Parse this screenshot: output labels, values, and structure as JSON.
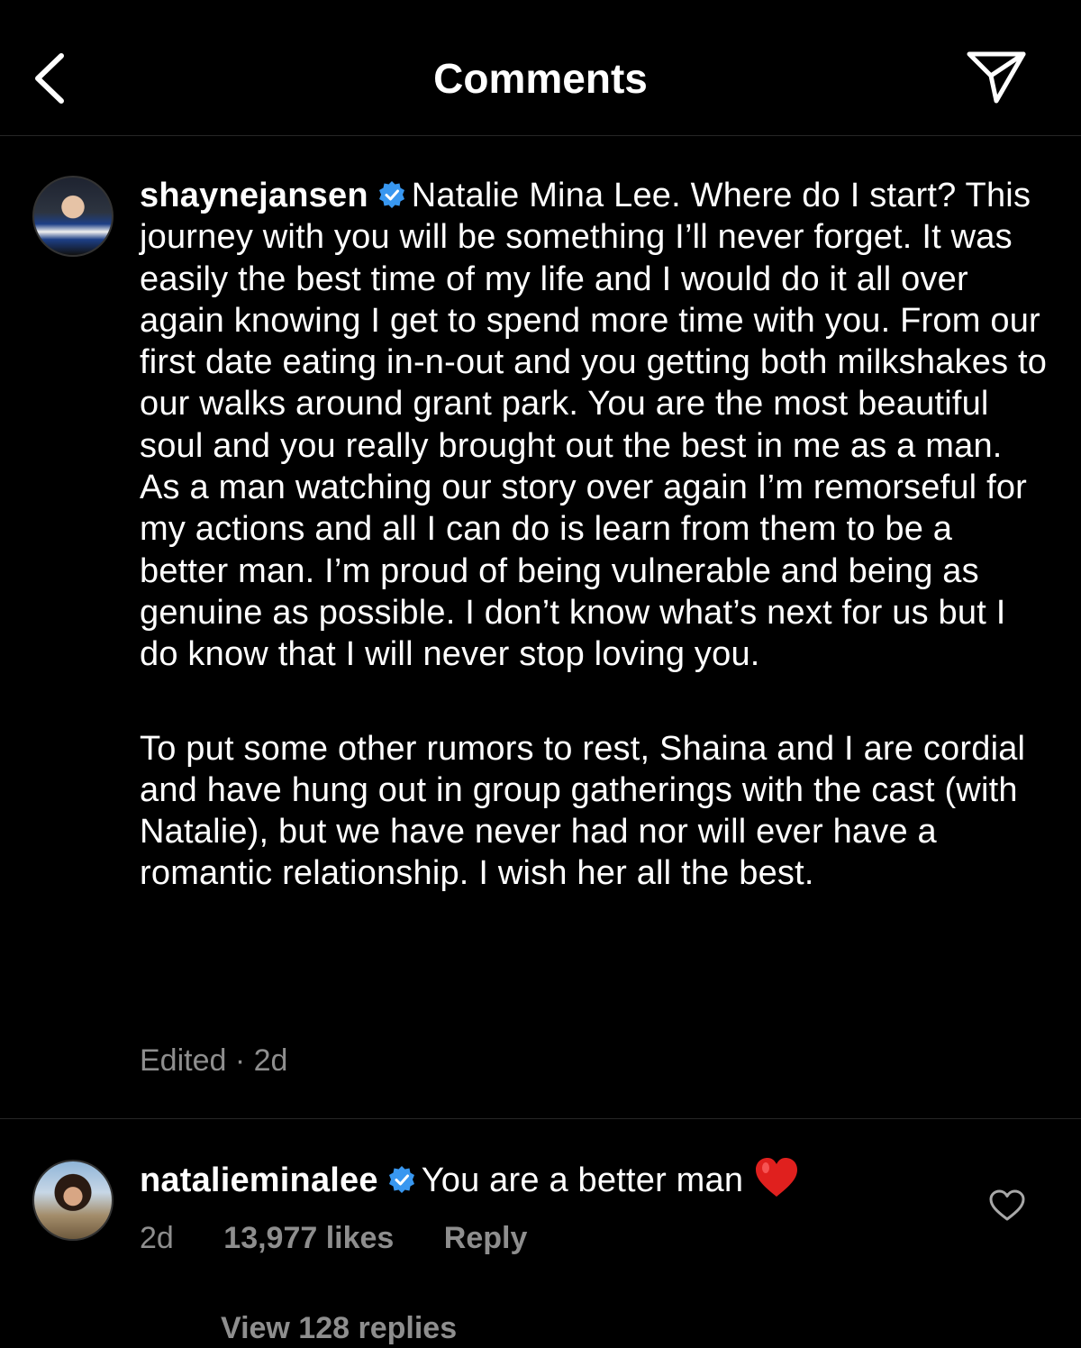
{
  "header": {
    "title": "Comments",
    "back_icon": "chevron-left-icon",
    "share_icon": "paper-plane-icon"
  },
  "comments": [
    {
      "username": "shaynejansen",
      "verified": true,
      "paragraphs": [
        "Natalie Mina Lee. Where do I start? This journey with you will be something I’ll never forget. It was easily the best time of my life and I would do it all over again knowing I get to spend more time with you. From our first date eating in-n-out and you getting both milkshakes to our walks around grant park. You are the most beautiful soul and you really brought out the best in me as a man. As a man watching our story over again I’m remorseful for my actions and all I can do is learn from them to be a better man. I’m proud of being vulnerable and being as genuine as possible. I don’t know what’s next for us but I do know that I will never stop loving you.",
        "To put some other rumors to rest, Shaina and I are cordial and have hung out in group gatherings with the cast (with Natalie), but we have never had nor will ever have a romantic relationship. I wish her all the best."
      ],
      "meta": "Edited · 2d"
    },
    {
      "username": "natalieminalee",
      "verified": true,
      "text": "You are a better man",
      "time": "2d",
      "likes": "13,977 likes",
      "reply_label": "Reply",
      "view_replies": "View 128 replies"
    }
  ],
  "colors": {
    "background": "#000000",
    "text": "#ffffff",
    "secondary_text": "#8e8e8e",
    "verified_badge": "#3897f0",
    "heart": "#e0201e",
    "divider": "#262626"
  }
}
